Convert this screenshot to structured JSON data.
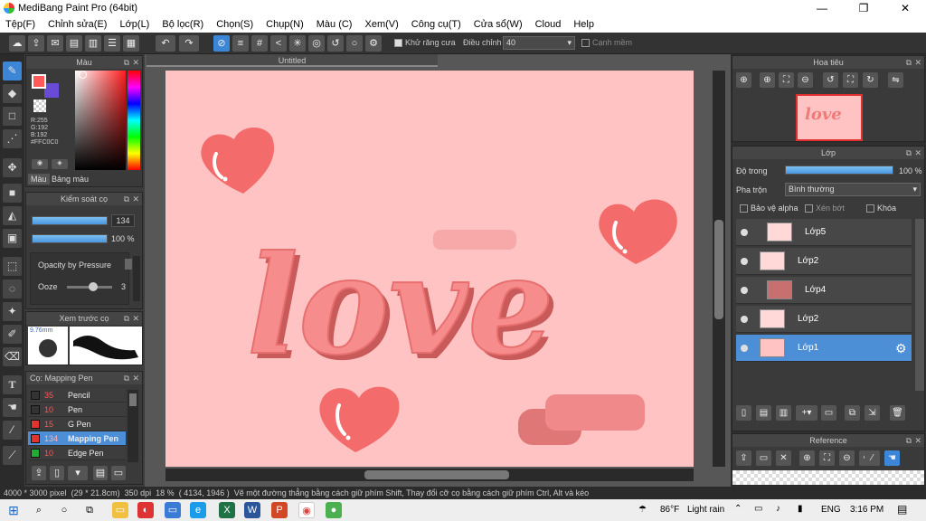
{
  "app": {
    "title": "MediBang Paint Pro (64bit)",
    "minimize": "—",
    "maximize": "❐",
    "close": "✕"
  },
  "menu": [
    "Tệp(F)",
    "Chỉnh sửa(E)",
    "Lớp(L)",
    "Bộ lọc(R)",
    "Chọn(S)",
    "Chụp(N)",
    "Màu (C)",
    "Xem(V)",
    "Công cụ(T)",
    "Cửa sổ(W)",
    "Cloud",
    "Help"
  ],
  "toolbar": {
    "antialias_label": "Khử răng cưa",
    "correction_label": "Điều chỉnh",
    "correction_value": "40",
    "soft_edge_label": "Cạnh mềm"
  },
  "color_panel": {
    "title": "Màu",
    "r": "R:255",
    "g": "G:192",
    "b": "B:192",
    "hex": "#FFC0C0",
    "tab_color": "Màu",
    "tab_palette": "Bảng màu",
    "main_color": "#ff5a5a",
    "sub_color": "#6a4bd8"
  },
  "brush_control": {
    "title": "Kiểm soát cọ",
    "size_value": "134",
    "size_level": 1.0,
    "opacity_value": "100 %",
    "opacity_level": 1.0,
    "opacity_by_pressure": "Opacity by Pressure",
    "ooze_label": "Ooze",
    "ooze_value": "3"
  },
  "preview": {
    "title": "Xem trước cọ",
    "size": "9.76mm"
  },
  "brush_list": {
    "title": "Cọ: Mapping Pen",
    "items": [
      {
        "num": "35",
        "name": "Pencil",
        "color": "#333333"
      },
      {
        "num": "10",
        "name": "Pen",
        "color": "#333333"
      },
      {
        "num": "15",
        "name": "G Pen",
        "color": "#e0342f"
      },
      {
        "num": "134",
        "name": "Mapping Pen",
        "color": "#e0342f",
        "selected": true
      },
      {
        "num": "10",
        "name": "Edge Pen",
        "color": "#22aa33"
      }
    ]
  },
  "document": {
    "tab": "Untitled",
    "canvas_color": "#ffc3c3",
    "artwork_text": "love"
  },
  "navigator": {
    "title": "Hoa tiêu"
  },
  "layers": {
    "title": "Lớp",
    "opacity_label": "Độ trong",
    "opacity_value": "100 %",
    "opacity_level": 1.0,
    "blend_label": "Pha trộn",
    "blend_value": "Bình thường",
    "protect_alpha": "Bảo vệ alpha",
    "clipping": "Xén bớt",
    "lock": "Khóa",
    "items": [
      {
        "name": "Lớp5",
        "selected": false
      },
      {
        "name": "Lớp2",
        "selected": false
      },
      {
        "name": "Lớp4",
        "selected": false
      },
      {
        "name": "Lớp2",
        "selected": false
      },
      {
        "name": "Lớp1",
        "selected": true
      }
    ]
  },
  "reference": {
    "title": "Reference"
  },
  "status": {
    "size": "4000 * 3000 pixel",
    "physical": "(29 * 21.8cm)",
    "dpi": "350 dpi",
    "zoom": "18 %",
    "coords": "( 4134, 1946 )",
    "hint": "Vẽ một đường thẳng bằng cách giữ phím Shift, Thay đổi cỡ cọ bằng cách giữ phím Ctrl, Alt và kéo"
  },
  "taskbar": {
    "weather_temp": "86°F",
    "weather_text": "Light rain",
    "lang": "ENG",
    "time": "3:16 PM"
  }
}
